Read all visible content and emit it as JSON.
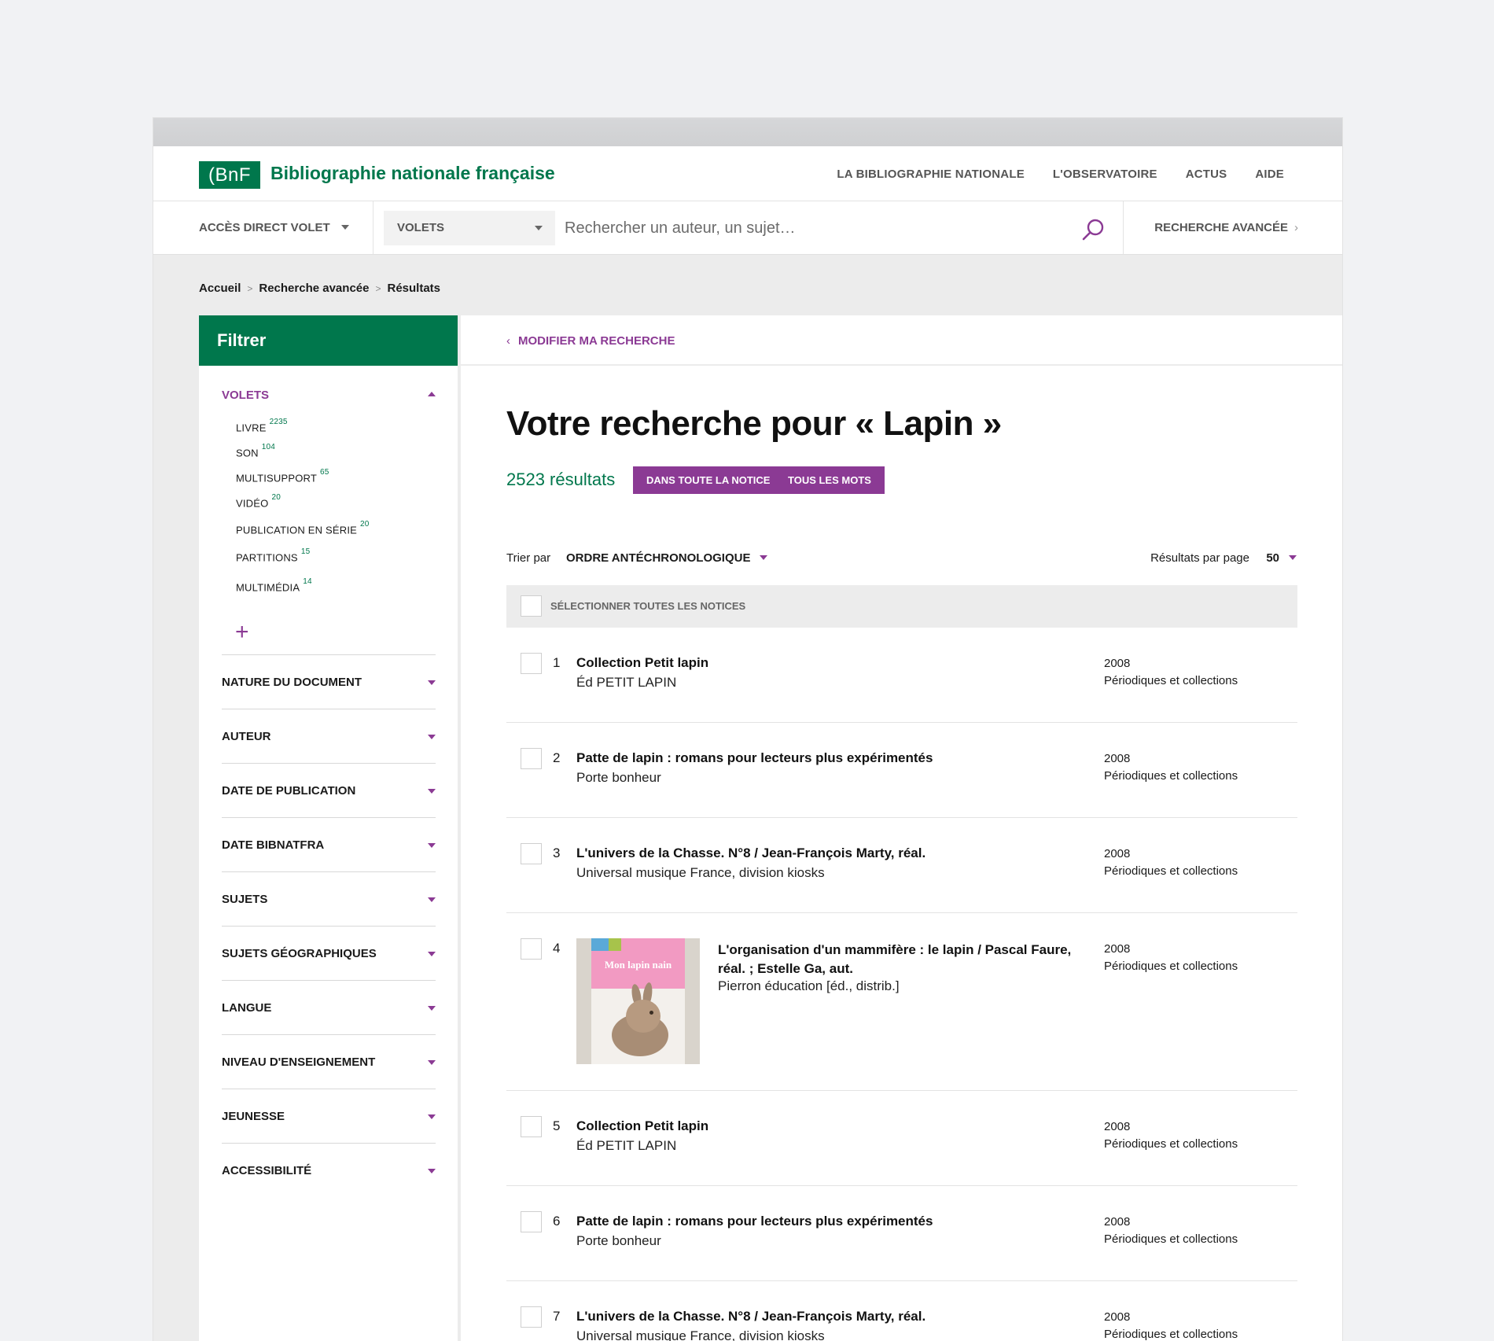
{
  "header": {
    "logo_text": "(BnF",
    "site_title": "Bibliographie nationale française",
    "nav": [
      "LA BIBLIOGRAPHIE NATIONALE",
      "L'OBSERVATOIRE",
      "ACTUS",
      "AIDE"
    ]
  },
  "search": {
    "direct_access": "ACCÈS DIRECT VOLET",
    "volets_select": "VOLETS",
    "placeholder": "Rechercher un auteur, un sujet…",
    "advanced": "RECHERCHE AVANCÉE"
  },
  "breadcrumb": [
    "Accueil",
    "Recherche avancée",
    "Résultats"
  ],
  "sidebar": {
    "filter_title": "Filtrer",
    "volets_label": "VOLETS",
    "volets": [
      {
        "label": "LIVRE",
        "count": "2235"
      },
      {
        "label": "SON",
        "count": "104"
      },
      {
        "label": "MULTISUPPORT",
        "count": "65"
      },
      {
        "label": "VIDÉO",
        "count": "20"
      },
      {
        "label": "PUBLICATION EN SÉRIE",
        "count": "20"
      },
      {
        "label": "PARTITIONS",
        "count": "15"
      },
      {
        "label": "MULTIMÉDIA",
        "count": "14"
      }
    ],
    "more": "+",
    "facets": [
      "NATURE DU DOCUMENT",
      "AUTEUR",
      "DATE DE PUBLICATION",
      "DATE BIBNATFRA",
      "SUJETS",
      "SUJETS GÉOGRAPHIQUES",
      "LANGUE",
      "NIVEAU D'ENSEIGNEMENT",
      "JEUNESSE",
      "ACCESSIBILITÉ"
    ]
  },
  "main": {
    "modify": "MODIFIER MA RECHERCHE",
    "title": "Votre recherche pour « Lapin »",
    "count": "2523 résultats",
    "pill1": "DANS TOUTE LA NOTICE",
    "pill2": "TOUS LES MOTS",
    "sort_label": "Trier par",
    "sort_value": "ORDRE ANTÉCHRONOLOGIQUE",
    "perpage_label": "Résultats par page",
    "perpage_value": "50",
    "select_all": "SÉLECTIONNER TOUTES LES NOTICES"
  },
  "results": [
    {
      "num": "1",
      "title": "Collection Petit lapin",
      "pub": "Éd PETIT LAPIN",
      "year": "2008",
      "type": "Périodiques et collections"
    },
    {
      "num": "2",
      "title": "Patte de lapin : romans pour lecteurs plus expérimentés",
      "pub": "Porte bonheur",
      "year": "2008",
      "type": "Périodiques et collections"
    },
    {
      "num": "3",
      "title": "L'univers de la Chasse. N°8 / Jean-François Marty, réal.",
      "pub": "Universal musique France, division kiosks",
      "year": "2008",
      "type": "Périodiques et collections"
    },
    {
      "num": "4",
      "title": "L'organisation d'un mammifère : le lapin / Pascal Faure, réal. ; Estelle Ga, aut.",
      "pub": "Pierron éducation [éd., distrib.]",
      "year": "2008",
      "type": "Périodiques et collections",
      "cover_title": "Mon lapin nain"
    },
    {
      "num": "5",
      "title": "Collection Petit lapin",
      "pub": "Éd PETIT LAPIN",
      "year": "2008",
      "type": "Périodiques et collections"
    },
    {
      "num": "6",
      "title": "Patte de lapin : romans pour lecteurs plus expérimentés",
      "pub": "Porte bonheur",
      "year": "2008",
      "type": "Périodiques et collections"
    },
    {
      "num": "7",
      "title": "L'univers de la Chasse. N°8 / Jean-François Marty, réal.",
      "pub": "Universal musique France, division kiosks",
      "year": "2008",
      "type": "Périodiques et collections"
    }
  ],
  "colors": {
    "brand_green": "#00774c",
    "accent_purple": "#8b3a94"
  }
}
